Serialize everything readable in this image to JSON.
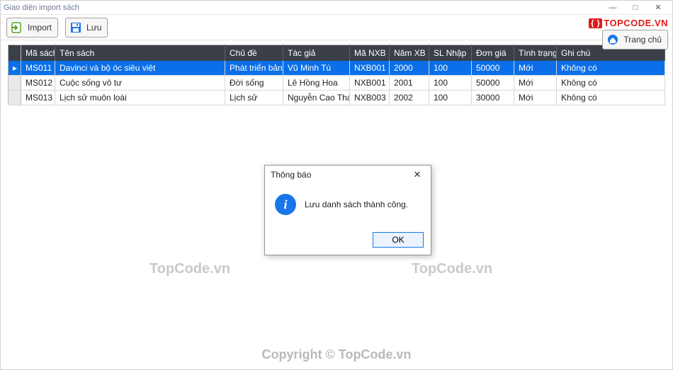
{
  "window": {
    "title": "Giao diện import sách",
    "min": "—",
    "max": "□",
    "close": "✕"
  },
  "toolbar": {
    "import_label": "Import",
    "save_label": "Lưu",
    "home_label": "Trang chủ"
  },
  "brand": {
    "curly": "{ }",
    "text": "TOPCODE.VN"
  },
  "table": {
    "columns": [
      "Mã sách",
      "Tên sách",
      "Chủ đề",
      "Tác giả",
      "Mã NXB",
      "Năm XB",
      "SL Nhập",
      "Đơn giá",
      "Tình trạng",
      "Ghi chú"
    ],
    "rows": [
      {
        "selected": true,
        "ma": "MS011",
        "ten": "Davinci và bộ óc siêu việt",
        "chude": "Phát triển bản thân",
        "tacgia": "Vũ Minh Tú",
        "manxb": "NXB001",
        "namxb": "2000",
        "slnhap": "100",
        "dongia": "50000",
        "tinhtrang": "Mới",
        "ghichu": "Không có"
      },
      {
        "selected": false,
        "ma": "MS012",
        "ten": "Cuộc sống vô tư",
        "chude": "Đời sống",
        "tacgia": "Lê Hồng Hoa",
        "manxb": "NXB001",
        "namxb": "2001",
        "slnhap": "100",
        "dongia": "50000",
        "tinhtrang": "Mới",
        "ghichu": "Không có"
      },
      {
        "selected": false,
        "ma": "MS013",
        "ten": "Lịch sử muôn loài",
        "chude": "Lịch sử",
        "tacgia": "Nguyễn Cao Thái",
        "manxb": "NXB003",
        "namxb": "2002",
        "slnhap": "100",
        "dongia": "30000",
        "tinhtrang": "Mới",
        "ghichu": "Không có"
      }
    ],
    "row_indicator": "▸"
  },
  "dialog": {
    "title": "Thông báo",
    "message": "Lưu danh sách thành công.",
    "ok_label": "OK",
    "close": "✕"
  },
  "watermarks": {
    "wm": "TopCode.vn",
    "copyright": "Copyright © TopCode.vn"
  }
}
